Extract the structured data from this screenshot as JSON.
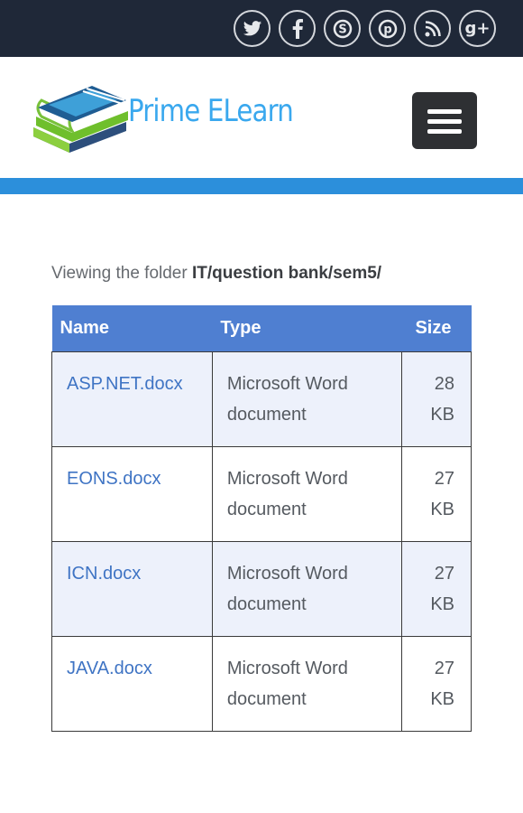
{
  "social": [
    {
      "name": "twitter-icon"
    },
    {
      "name": "facebook-icon"
    },
    {
      "name": "skype-icon"
    },
    {
      "name": "pinterest-icon"
    },
    {
      "name": "rss-icon"
    },
    {
      "name": "google-plus-icon",
      "label": "g+"
    }
  ],
  "brand": {
    "name": "Prime ELearn",
    "color": "#3aa8ee"
  },
  "colors": {
    "topbar": "#1f2838",
    "accent_bar": "#2c8fdb",
    "table_header": "#4f7fd1",
    "link": "#3f74c4"
  },
  "folder": {
    "prefix": "Viewing the folder ",
    "path": "IT/question bank/sem5/"
  },
  "table": {
    "headers": {
      "name": "Name",
      "type": "Type",
      "size": "Size"
    },
    "rows": [
      {
        "name": "ASP.NET.docx",
        "type": "Microsoft Word document",
        "size": "28 KB"
      },
      {
        "name": "EONS.docx",
        "type": "Microsoft Word document",
        "size": "27 KB"
      },
      {
        "name": "ICN.docx",
        "type": "Microsoft Word document",
        "size": "27 KB"
      },
      {
        "name": "JAVA.docx",
        "type": "Microsoft Word document",
        "size": "27 KB"
      }
    ]
  }
}
